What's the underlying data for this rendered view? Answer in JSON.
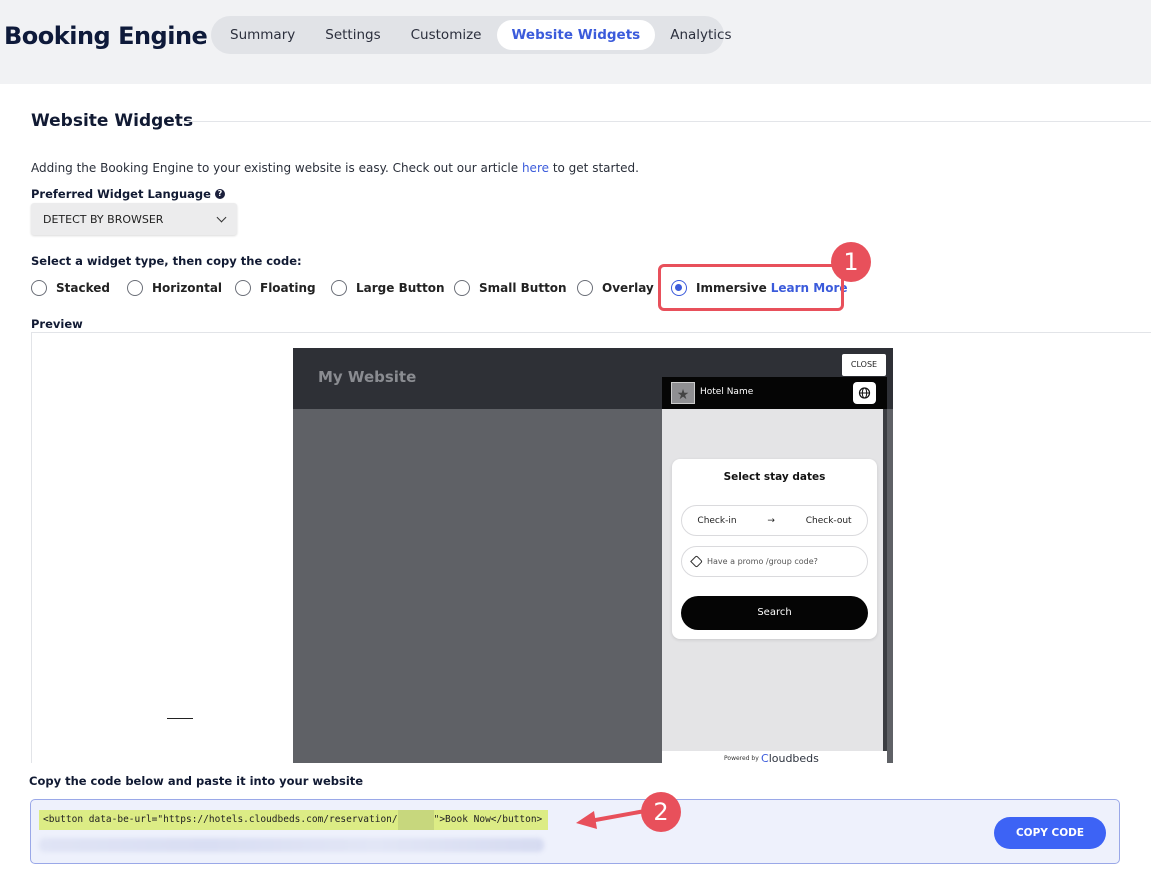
{
  "header": {
    "app_title": "Booking Engine",
    "tabs": [
      {
        "label": "Summary",
        "active": false
      },
      {
        "label": "Settings",
        "active": false
      },
      {
        "label": "Customize",
        "active": false
      },
      {
        "label": "Website Widgets",
        "active": true
      },
      {
        "label": "Analytics",
        "active": false
      }
    ]
  },
  "section": {
    "title": "Website Widgets",
    "intro_before": "Adding the Booking Engine to your existing website is easy. Check out our article ",
    "intro_link": "here",
    "intro_after": " to get started."
  },
  "language": {
    "label": "Preferred Widget Language",
    "selected": "DETECT BY BROWSER"
  },
  "widget_type": {
    "label": "Select a widget type, then copy the code:",
    "options": [
      {
        "label": "Stacked",
        "checked": false
      },
      {
        "label": "Horizontal",
        "checked": false
      },
      {
        "label": "Floating",
        "checked": false
      },
      {
        "label": "Large Button",
        "checked": false
      },
      {
        "label": "Small Button",
        "checked": false
      },
      {
        "label": "Overlay",
        "checked": false
      },
      {
        "label": "Immersive",
        "checked": true
      }
    ],
    "learn_more": "Learn More"
  },
  "callouts": {
    "badge_1": "1",
    "badge_2": "2"
  },
  "preview": {
    "label": "Preview",
    "site_title": "My Website",
    "close_label": "CLOSE",
    "hotel_name": "Hotel Name",
    "card_title": "Select stay dates",
    "check_in": "Check-in",
    "arrow": "→",
    "check_out": "Check-out",
    "promo_placeholder": "Have a promo /group code?",
    "search_label": "Search",
    "powered_by": "Powered by",
    "brand_prefix": "C",
    "brand_rest": "loudbeds"
  },
  "code": {
    "label": "Copy the code below and paste it into your website",
    "code_start": "<button data-be-url=\"https://hotels.cloudbeds.com/reservation/",
    "code_end": "\">Book Now</button>",
    "copy_button": "COPY CODE"
  },
  "colors": {
    "accent": "#3b5bdb",
    "callout": "#e8505b",
    "highlight": "#dcec85"
  }
}
